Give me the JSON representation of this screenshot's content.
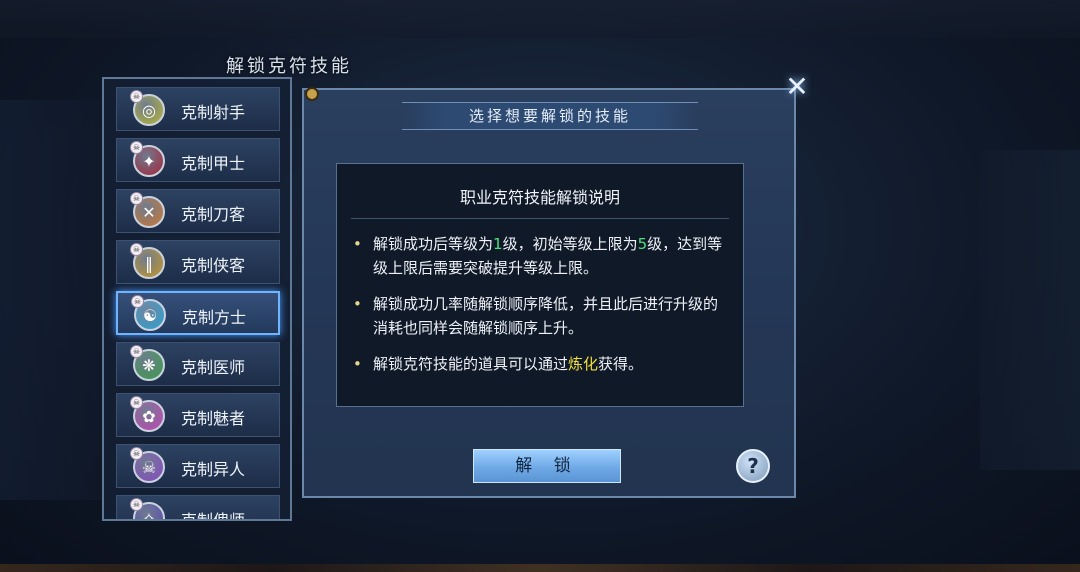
{
  "window_title": "解锁克符技能",
  "skills": [
    {
      "label": "克制射手",
      "color": "#b9b93a",
      "glyph": "◎"
    },
    {
      "label": "克制甲士",
      "color": "#a8263a",
      "glyph": "✦"
    },
    {
      "label": "克制刀客",
      "color": "#d07a34",
      "glyph": "✕"
    },
    {
      "label": "克制侠客",
      "color": "#c99a2a",
      "glyph": "‖"
    },
    {
      "label": "克制方士",
      "color": "#2aa6d6",
      "glyph": "☯"
    },
    {
      "label": "克制医师",
      "color": "#3aa04a",
      "glyph": "❋"
    },
    {
      "label": "克制魅者",
      "color": "#c848b8",
      "glyph": "✿"
    },
    {
      "label": "克制异人",
      "color": "#8a4ac8",
      "glyph": "☠"
    },
    {
      "label": "克制傀师",
      "color": "#5a4ab0",
      "glyph": "✧"
    }
  ],
  "dialog": {
    "header": "选择想要解锁的技能",
    "unlock_button": "解 锁",
    "help_button": "?"
  },
  "info": {
    "title": "职业克符技能解锁说明",
    "bullet1": {
      "a": "解锁成功后等级为",
      "n1": "1",
      "b": "级，初始等级上限为",
      "n2": "5",
      "c": "级，达到等级上限后需要突破提升等级上限。"
    },
    "bullet2": "解锁成功几率随解锁顺序降低，并且此后进行升级的消耗也同样会随解锁顺序上升。",
    "bullet3": {
      "a": "解锁克符技能的道具可以通过",
      "b": "炼化",
      "c": "获得。"
    }
  }
}
